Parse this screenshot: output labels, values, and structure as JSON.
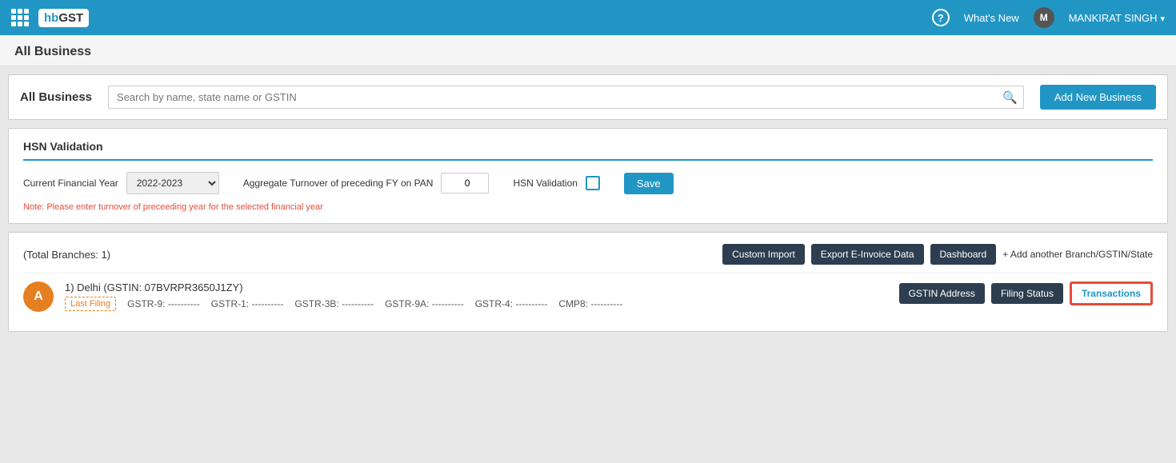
{
  "topnav": {
    "logo_hb": "hb",
    "logo_gst": "GST",
    "whats_new": "What's New",
    "user_initial": "M",
    "user_name": "MANKIRAT SINGH",
    "help_symbol": "?"
  },
  "page_header": {
    "title": "All Business"
  },
  "all_business_bar": {
    "title": "All Business",
    "search_placeholder": "Search by name, state name or GSTIN",
    "add_new_label": "Add New Business"
  },
  "hsn_section": {
    "title": "HSN Validation",
    "current_fy_label": "Current Financial Year",
    "current_fy_value": "2022-2023",
    "aggregate_label": "Aggregate Turnover of preceding FY on PAN",
    "aggregate_value": "0",
    "hsn_validation_label": "HSN Validation",
    "save_label": "Save",
    "note": "Note: Please enter turnover of preceeding year for the selected financial year"
  },
  "business_list": {
    "total_branches": "(Total Branches: 1)",
    "custom_import_label": "Custom Import",
    "export_einvoice_label": "Export E-Invoice Data",
    "dashboard_label": "Dashboard",
    "add_branch_label": "+ Add another Branch/GSTIN/State",
    "items": [
      {
        "avatar": "A",
        "name_line": "1) Delhi (GSTIN: 07BVRPR3650J1ZY)",
        "last_filing_label": "Last Filing",
        "filing_items": [
          "GSTR-9: ----------",
          "GSTR-1: ----------",
          "GSTR-3B: ----------",
          "GSTR-9A: ----------",
          "GSTR-4: ----------",
          "CMP8: ----------"
        ],
        "gstin_address_label": "GSTIN Address",
        "filing_status_label": "Filing Status",
        "transactions_label": "Transactions"
      }
    ]
  }
}
